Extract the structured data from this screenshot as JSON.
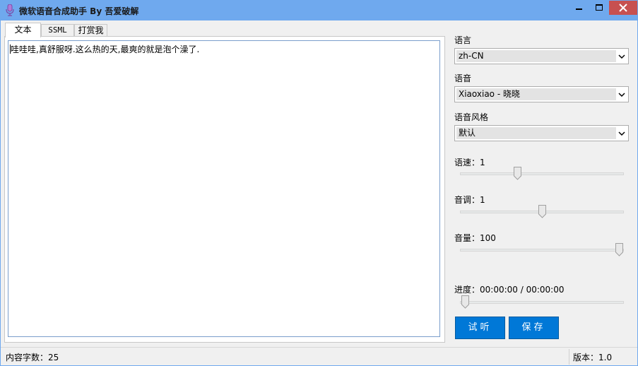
{
  "window": {
    "title": "微软语音合成助手 By 吾爱破解",
    "accent_color": "#6fa9ee",
    "close_color": "#c75050"
  },
  "tabs": [
    {
      "label": "文本",
      "active": true
    },
    {
      "label": "SSML",
      "active": false
    },
    {
      "label": "打赏我",
      "active": false
    }
  ],
  "editor": {
    "text": "哇哇哇,真舒服呀.这么热的天,最爽的就是泡个澡了."
  },
  "settings": {
    "language_label": "语言",
    "language_value": "zh-CN",
    "voice_label": "语音",
    "voice_value": "Xiaoxiao - 晓晓",
    "style_label": "语音风格",
    "style_value": "默认",
    "rate_label": "语速：1",
    "rate_level": 0.34,
    "pitch_label": "音调：1",
    "pitch_level": 0.5,
    "volume_label": "音量：100",
    "volume_level": 1.0,
    "progress_label": "进度：00:00:00 / 00:00:00",
    "progress_level": 0.0
  },
  "buttons": {
    "preview": "试听",
    "save": "保存",
    "color": "#0078d7"
  },
  "status": {
    "char_count": "内容字数：25",
    "version": "版本：1.0"
  }
}
